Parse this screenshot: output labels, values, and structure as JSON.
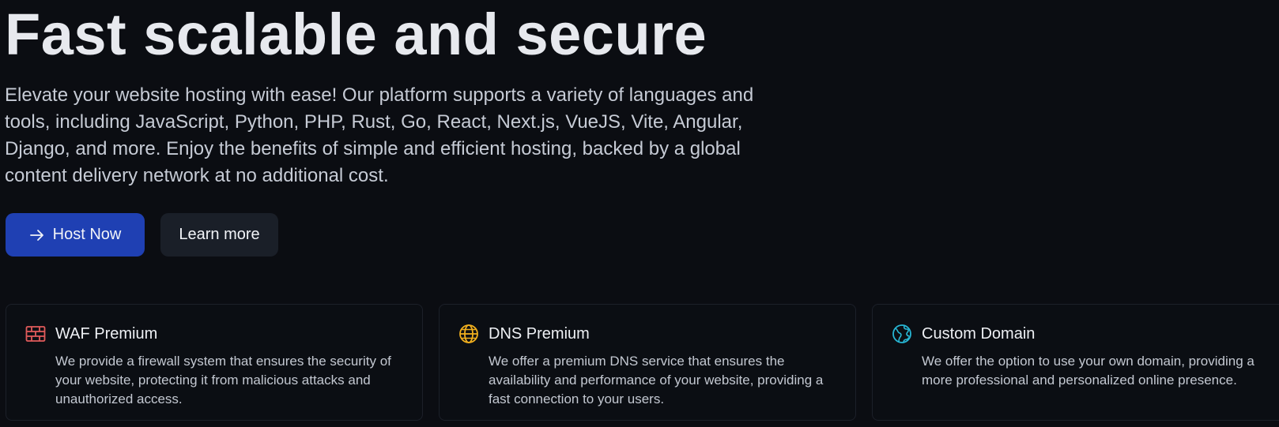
{
  "hero": {
    "title": "Fast scalable and secure",
    "description": "Elevate your website hosting with ease! Our platform supports a variety of languages and tools, including JavaScript, Python, PHP, Rust, Go, React, Next.js, VueJS, Vite, Angular, Django, and more. Enjoy the benefits of simple and efficient hosting, backed by a global content delivery network at no additional cost.",
    "primary_button": "Host Now",
    "secondary_button": "Learn more"
  },
  "features": [
    {
      "title": "WAF Premium",
      "text": "We provide a firewall system that ensures the security of your website, protecting it from malicious attacks and unauthorized access.",
      "icon": "firewall-icon",
      "color": "#e15b5b"
    },
    {
      "title": "DNS Premium",
      "text": "We offer a premium DNS service that ensures the availability and performance of your website, providing a fast connection to your users.",
      "icon": "globe-icon",
      "color": "#f2b01e"
    },
    {
      "title": "Custom Domain",
      "text": "We offer the option to use your own domain, providing a more professional and personalized online presence.",
      "icon": "earth-icon",
      "color": "#27b6d4"
    }
  ],
  "colors": {
    "background": "#0b0d12",
    "primary": "#1f40b3",
    "secondary": "#1a1f28"
  }
}
